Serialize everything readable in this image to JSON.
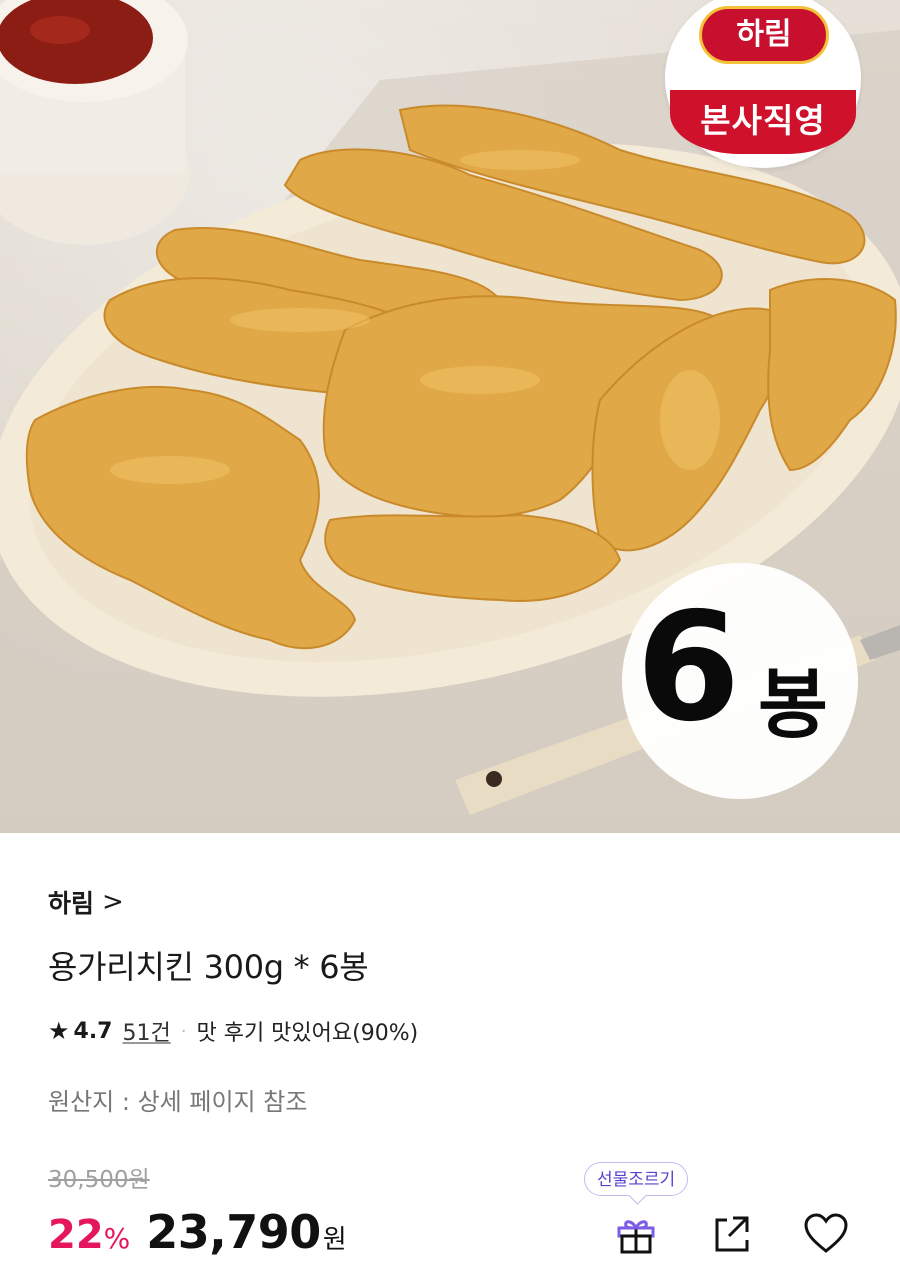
{
  "hero": {
    "brand_logo_text": "하림",
    "brand_banner_text": "본사직영",
    "pack_number": "6",
    "pack_unit": "봉"
  },
  "product": {
    "brand": "하림",
    "brand_chevron": ">",
    "title": "용가리치킨 300g * 6봉",
    "rating": {
      "star": "★",
      "score": "4.7",
      "review_count": "51건",
      "separator": "·",
      "taste_summary": "맛 후기 맛있어요(90%)"
    },
    "origin": "원산지 : 상세 페이지 참조",
    "price": {
      "original": "30,500원",
      "discount_number": "22",
      "discount_symbol": "%",
      "sale_number": "23,790",
      "sale_unit": "원"
    }
  },
  "actions": {
    "gift_tooltip": "선물조르기",
    "icons": [
      "gift-icon",
      "share-icon",
      "heart-icon"
    ]
  },
  "colors": {
    "accent_pink": "#e4165d",
    "gift_purple": "#5a3fd0",
    "brand_red": "#c8102e"
  }
}
